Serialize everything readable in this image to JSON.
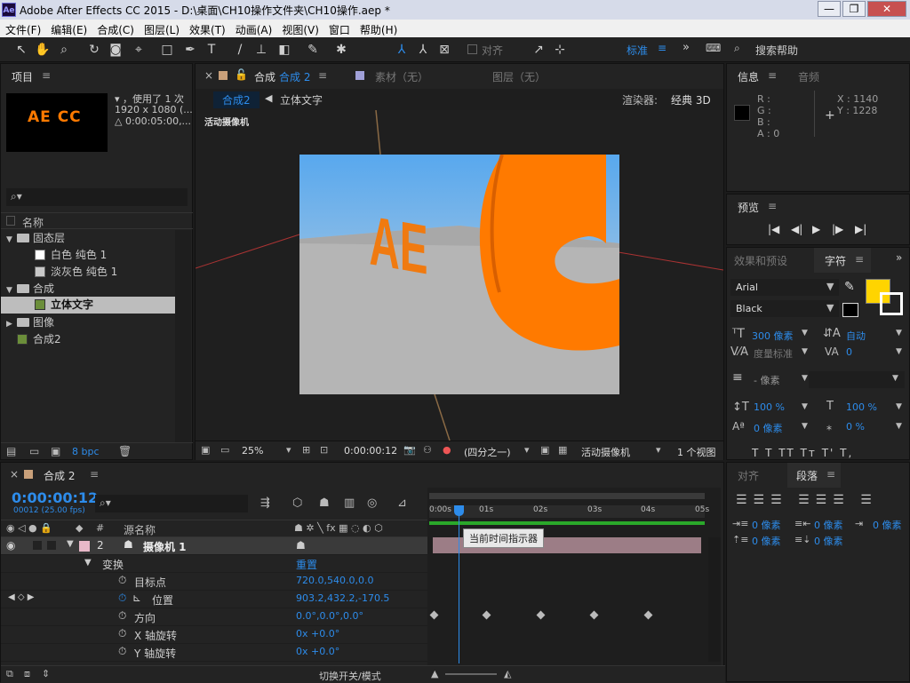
{
  "window": {
    "title": "Adobe After Effects CC 2015 - D:\\桌面\\CH10操作文件夹\\CH10操作.aep *",
    "icon": "Ae",
    "min": "—",
    "max": "❐",
    "close": "✕"
  },
  "menu": [
    "文件(F)",
    "编辑(E)",
    "合成(C)",
    "图层(L)",
    "效果(T)",
    "动画(A)",
    "视图(V)",
    "窗口",
    "帮助(H)"
  ],
  "toolbar": {
    "align": "对齐",
    "workspace": "标准",
    "search": "搜索帮助"
  },
  "project": {
    "tab": "项目",
    "thumb_text": "AE CC",
    "info1": "▾ ，使用了 1 次",
    "info2": "1920 x 1080 (...",
    "info3": "△ 0:00:05:00,...",
    "col_name": "名称",
    "items": [
      {
        "label": "固态层",
        "type": "folder"
      },
      {
        "label": "白色 纯色 1",
        "type": "solid",
        "color": "#ffffff"
      },
      {
        "label": "淡灰色 纯色 1",
        "type": "solid",
        "color": "#c8c8c8"
      },
      {
        "label": "合成",
        "type": "folder"
      },
      {
        "label": "立体文字",
        "type": "comp",
        "selected": true
      },
      {
        "label": "图像",
        "type": "folder"
      },
      {
        "label": "合成2",
        "type": "comp"
      }
    ],
    "bpc": "8 bpc"
  },
  "comp_panel": {
    "tab_prefix": "合成",
    "tab_name": "合成 2",
    "footage_tab": "素材（无）",
    "layer_tab": "图层（无）",
    "crumb1": "合成2",
    "crumb2": "立体文字",
    "renderer_label": "渲染器:",
    "renderer": "经典 3D",
    "view_label": "活动摄像机",
    "zoom": "25%",
    "time": "0:00:00:12",
    "resolution": "(四分之一)",
    "camera": "活动摄像机",
    "views": "1 个视图"
  },
  "info_panel": {
    "tab": "信息",
    "tab2": "音频",
    "r": "R :",
    "g": "G :",
    "b": "B :",
    "a": "A : 0",
    "x": "X : 1140",
    "y": "Y : 1228"
  },
  "preview": {
    "tab": "预览"
  },
  "char_panel": {
    "tab_effects": "效果和预设",
    "tab": "字符",
    "font": "Arial",
    "style": "Black",
    "size": "300 像素",
    "leading": "自动",
    "kerning": "度量标准",
    "tracking": "0",
    "stroke": "- 像素",
    "vscale": "100 %",
    "hscale": "100 %",
    "baseline": "0 像素",
    "tsume": "0 %",
    "fill_color": "#ffd400",
    "styles": "T  T  TT  Tт  T'  T,"
  },
  "para_panel": {
    "tab1": "对齐",
    "tab2": "段落",
    "indent1": "0 像素",
    "indent2": "0 像素",
    "indent3": "0 像素",
    "space1": "0 像素",
    "space2": "0 像素"
  },
  "timeline": {
    "tab": "合成 2",
    "timecode": "0:00:00:12",
    "frames": "00012 (25.00 fps)",
    "col_num": "#",
    "col_source": "源名称",
    "tooltip": "当前时间指示器",
    "ruler": [
      "0:00s",
      "01s",
      "02s",
      "03s",
      "04s",
      "05s"
    ],
    "layer": {
      "num": "2",
      "name": "摄像机 1"
    },
    "transform": "变换",
    "reset": "重置",
    "props": [
      {
        "name": "目标点",
        "value": "720.0,540.0,0.0"
      },
      {
        "name": "位置",
        "value": "903.2,432.2,-170.5"
      },
      {
        "name": "方向",
        "value": "0.0°,0.0°,0.0°"
      },
      {
        "name": "X 轴旋转",
        "value": "0x +0.0°"
      },
      {
        "name": "Y 轴旋转",
        "value": "0x +0.0°"
      }
    ],
    "footer": "切换开关/模式"
  },
  "colors": {
    "accent": "#2d8ceb",
    "orange": "#ff7a00",
    "sky": "#5aa0e0"
  }
}
